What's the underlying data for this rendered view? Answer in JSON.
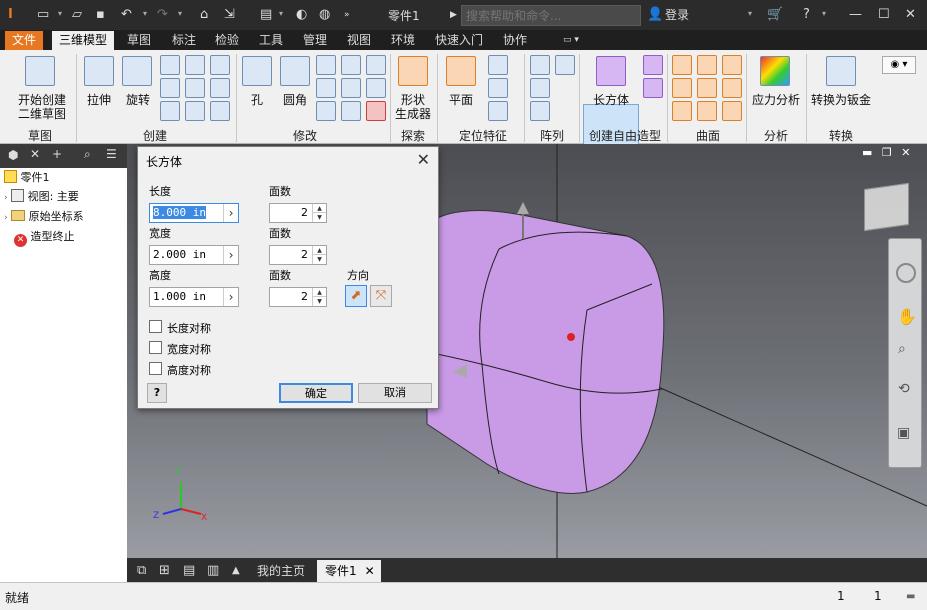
{
  "titlebar": {
    "document_title": "零件1",
    "search_placeholder": "搜索帮助和命令...",
    "login_label": "登录"
  },
  "menubar": {
    "tabs": [
      "文件",
      "三维模型",
      "草图",
      "标注",
      "检验",
      "工具",
      "管理",
      "视图",
      "环境",
      "快速入门",
      "协作"
    ],
    "active_tab": "三维模型"
  },
  "ribbon": {
    "groups": {
      "sketch": {
        "title": "草图",
        "start_sketch": "开始创建\n二维草图"
      },
      "create": {
        "title": "创建",
        "extrude": "拉伸",
        "revolve": "旋转"
      },
      "modify": {
        "title": "修改",
        "hole": "孔",
        "fillet": "圆角"
      },
      "explore": {
        "title": "探索",
        "shape_generator": "形状\n生成器"
      },
      "work_features": {
        "title": "定位特征",
        "plane": "平面"
      },
      "pattern": {
        "title": "阵列"
      },
      "freeform": {
        "title": "创建自由造型",
        "box": "长方体"
      },
      "surface": {
        "title": "曲面"
      },
      "simulation": {
        "title": "分析",
        "stress": "应力分析"
      },
      "convert": {
        "title": "转换",
        "to_sheet_metal": "转换为钣金"
      }
    }
  },
  "browser": {
    "items": [
      {
        "label": "零件1"
      },
      {
        "label": "视图: 主要"
      },
      {
        "label": "原始坐标系"
      },
      {
        "label": "造型终止"
      }
    ]
  },
  "dialog": {
    "title": "长方体",
    "length_label": "长度",
    "length_value": "8.000 in",
    "length_faces_label": "面数",
    "length_faces": "2",
    "width_label": "宽度",
    "width_value": "2.000 in",
    "width_faces_label": "面数",
    "width_faces": "2",
    "height_label": "高度",
    "height_value": "1.000 in",
    "height_faces_label": "面数",
    "height_faces": "2",
    "direction_label": "方向",
    "sym_length": "长度对称",
    "sym_width": "宽度对称",
    "sym_height": "高度对称",
    "ok": "确定",
    "cancel": "取消"
  },
  "doc_tabs": {
    "home": "我的主页",
    "part": "零件1"
  },
  "status": {
    "text": "就绪",
    "count1": "1",
    "count2": "1"
  },
  "colors": {
    "accent": "#e87722",
    "body": "#cc99ee",
    "selection": "#3c8ae3"
  }
}
